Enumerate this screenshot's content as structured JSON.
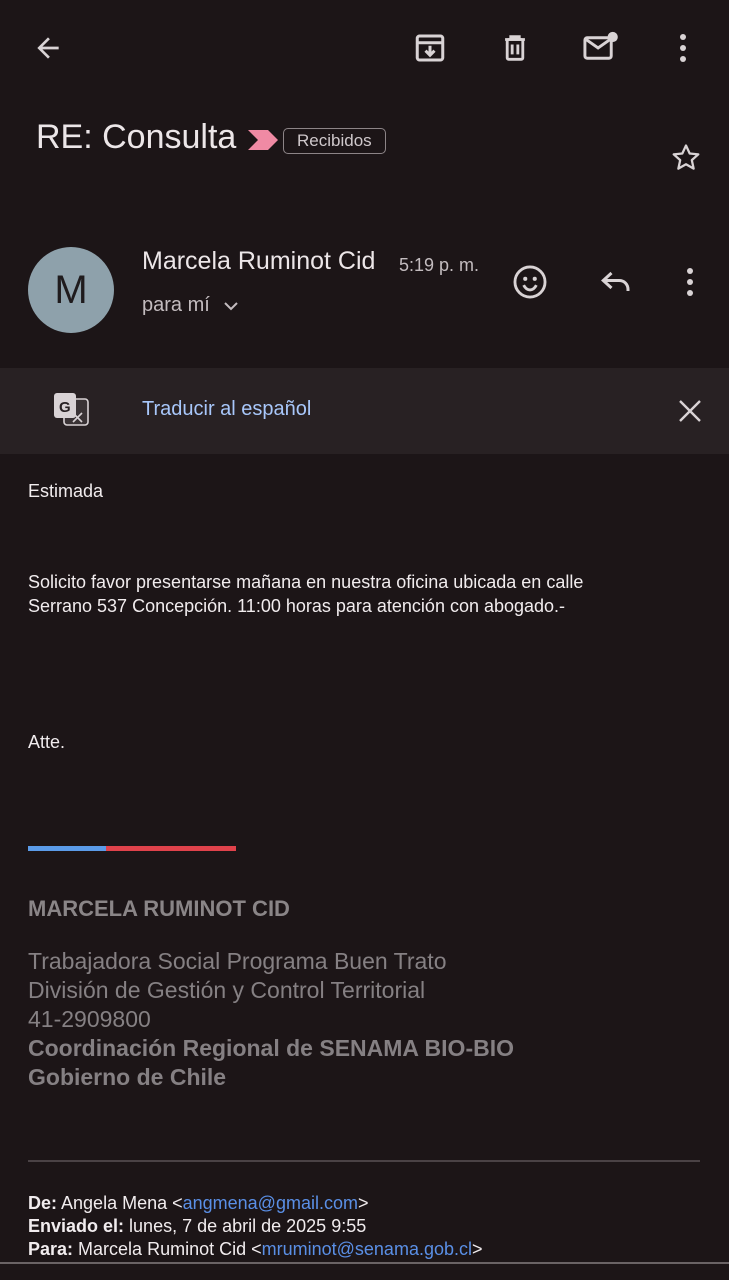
{
  "toolbar": {
    "back_icon": "arrow-left-icon",
    "archive_icon": "archive-icon",
    "delete_icon": "trash-icon",
    "mark_unread_icon": "mark-unread-icon",
    "more_icon": "more-vert-icon"
  },
  "email": {
    "subject": "RE: Consulta",
    "label_chip": "Recibidos",
    "star_icon": "star-icon",
    "important_icon": "important-marker-icon",
    "sender": {
      "initial": "M",
      "name": "Marcela Ruminot Cid",
      "time": "5:19 p. m.",
      "to": "para mí",
      "avatar_color": "#8ea1ab"
    }
  },
  "translate": {
    "label": "Traducir al español",
    "icon": "translate-icon",
    "close_icon": "close-icon"
  },
  "body": {
    "greeting": "Estimada",
    "line1": "Solicito favor presentarse mañana en nuestra oficina ubicada en calle",
    "line2": "Serrano 537 Concepción. 11:00 horas para atención con abogado.-",
    "closing": "Atte."
  },
  "signature": {
    "name": "MARCELA RUMINOT CID",
    "title": "Trabajadora Social Programa Buen Trato",
    "division": "División de Gestión y Control Territorial",
    "phone": "41-2909800",
    "org": "Coordinación Regional de SENAMA BIO-BIO",
    "gov": "Gobierno de Chile",
    "flag_colors": [
      "#5b9be8",
      "#e0424b"
    ]
  },
  "quoted_header": {
    "from_label": "De:",
    "from_name": "Angela Mena <",
    "from_email": "angmena@gmail.com",
    "from_close": ">",
    "sent_label": "Enviado el:",
    "sent_value": "lunes, 7 de abril de 2025 9:55",
    "to_label": "Para:",
    "to_name": "Marcela Ruminot Cid <",
    "to_email": "mruminot@senama.gob.cl",
    "to_close": ">"
  },
  "colors": {
    "background": "#1c1517",
    "link": "#a8c7fa",
    "important": "#f08aa4"
  }
}
